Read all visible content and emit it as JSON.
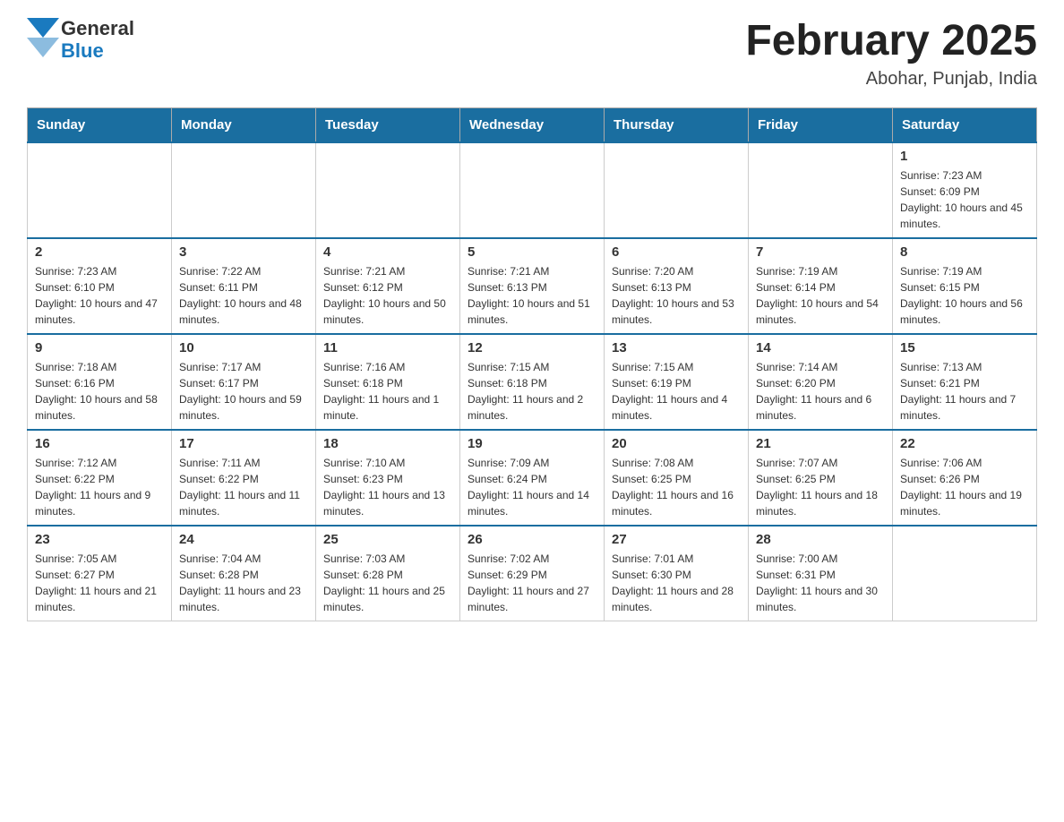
{
  "header": {
    "logo_general": "General",
    "logo_blue": "Blue",
    "month_title": "February 2025",
    "location": "Abohar, Punjab, India"
  },
  "weekdays": [
    "Sunday",
    "Monday",
    "Tuesday",
    "Wednesday",
    "Thursday",
    "Friday",
    "Saturday"
  ],
  "weeks": [
    [
      {
        "day": "",
        "sunrise": "",
        "sunset": "",
        "daylight": ""
      },
      {
        "day": "",
        "sunrise": "",
        "sunset": "",
        "daylight": ""
      },
      {
        "day": "",
        "sunrise": "",
        "sunset": "",
        "daylight": ""
      },
      {
        "day": "",
        "sunrise": "",
        "sunset": "",
        "daylight": ""
      },
      {
        "day": "",
        "sunrise": "",
        "sunset": "",
        "daylight": ""
      },
      {
        "day": "",
        "sunrise": "",
        "sunset": "",
        "daylight": ""
      },
      {
        "day": "1",
        "sunrise": "Sunrise: 7:23 AM",
        "sunset": "Sunset: 6:09 PM",
        "daylight": "Daylight: 10 hours and 45 minutes."
      }
    ],
    [
      {
        "day": "2",
        "sunrise": "Sunrise: 7:23 AM",
        "sunset": "Sunset: 6:10 PM",
        "daylight": "Daylight: 10 hours and 47 minutes."
      },
      {
        "day": "3",
        "sunrise": "Sunrise: 7:22 AM",
        "sunset": "Sunset: 6:11 PM",
        "daylight": "Daylight: 10 hours and 48 minutes."
      },
      {
        "day": "4",
        "sunrise": "Sunrise: 7:21 AM",
        "sunset": "Sunset: 6:12 PM",
        "daylight": "Daylight: 10 hours and 50 minutes."
      },
      {
        "day": "5",
        "sunrise": "Sunrise: 7:21 AM",
        "sunset": "Sunset: 6:13 PM",
        "daylight": "Daylight: 10 hours and 51 minutes."
      },
      {
        "day": "6",
        "sunrise": "Sunrise: 7:20 AM",
        "sunset": "Sunset: 6:13 PM",
        "daylight": "Daylight: 10 hours and 53 minutes."
      },
      {
        "day": "7",
        "sunrise": "Sunrise: 7:19 AM",
        "sunset": "Sunset: 6:14 PM",
        "daylight": "Daylight: 10 hours and 54 minutes."
      },
      {
        "day": "8",
        "sunrise": "Sunrise: 7:19 AM",
        "sunset": "Sunset: 6:15 PM",
        "daylight": "Daylight: 10 hours and 56 minutes."
      }
    ],
    [
      {
        "day": "9",
        "sunrise": "Sunrise: 7:18 AM",
        "sunset": "Sunset: 6:16 PM",
        "daylight": "Daylight: 10 hours and 58 minutes."
      },
      {
        "day": "10",
        "sunrise": "Sunrise: 7:17 AM",
        "sunset": "Sunset: 6:17 PM",
        "daylight": "Daylight: 10 hours and 59 minutes."
      },
      {
        "day": "11",
        "sunrise": "Sunrise: 7:16 AM",
        "sunset": "Sunset: 6:18 PM",
        "daylight": "Daylight: 11 hours and 1 minute."
      },
      {
        "day": "12",
        "sunrise": "Sunrise: 7:15 AM",
        "sunset": "Sunset: 6:18 PM",
        "daylight": "Daylight: 11 hours and 2 minutes."
      },
      {
        "day": "13",
        "sunrise": "Sunrise: 7:15 AM",
        "sunset": "Sunset: 6:19 PM",
        "daylight": "Daylight: 11 hours and 4 minutes."
      },
      {
        "day": "14",
        "sunrise": "Sunrise: 7:14 AM",
        "sunset": "Sunset: 6:20 PM",
        "daylight": "Daylight: 11 hours and 6 minutes."
      },
      {
        "day": "15",
        "sunrise": "Sunrise: 7:13 AM",
        "sunset": "Sunset: 6:21 PM",
        "daylight": "Daylight: 11 hours and 7 minutes."
      }
    ],
    [
      {
        "day": "16",
        "sunrise": "Sunrise: 7:12 AM",
        "sunset": "Sunset: 6:22 PM",
        "daylight": "Daylight: 11 hours and 9 minutes."
      },
      {
        "day": "17",
        "sunrise": "Sunrise: 7:11 AM",
        "sunset": "Sunset: 6:22 PM",
        "daylight": "Daylight: 11 hours and 11 minutes."
      },
      {
        "day": "18",
        "sunrise": "Sunrise: 7:10 AM",
        "sunset": "Sunset: 6:23 PM",
        "daylight": "Daylight: 11 hours and 13 minutes."
      },
      {
        "day": "19",
        "sunrise": "Sunrise: 7:09 AM",
        "sunset": "Sunset: 6:24 PM",
        "daylight": "Daylight: 11 hours and 14 minutes."
      },
      {
        "day": "20",
        "sunrise": "Sunrise: 7:08 AM",
        "sunset": "Sunset: 6:25 PM",
        "daylight": "Daylight: 11 hours and 16 minutes."
      },
      {
        "day": "21",
        "sunrise": "Sunrise: 7:07 AM",
        "sunset": "Sunset: 6:25 PM",
        "daylight": "Daylight: 11 hours and 18 minutes."
      },
      {
        "day": "22",
        "sunrise": "Sunrise: 7:06 AM",
        "sunset": "Sunset: 6:26 PM",
        "daylight": "Daylight: 11 hours and 19 minutes."
      }
    ],
    [
      {
        "day": "23",
        "sunrise": "Sunrise: 7:05 AM",
        "sunset": "Sunset: 6:27 PM",
        "daylight": "Daylight: 11 hours and 21 minutes."
      },
      {
        "day": "24",
        "sunrise": "Sunrise: 7:04 AM",
        "sunset": "Sunset: 6:28 PM",
        "daylight": "Daylight: 11 hours and 23 minutes."
      },
      {
        "day": "25",
        "sunrise": "Sunrise: 7:03 AM",
        "sunset": "Sunset: 6:28 PM",
        "daylight": "Daylight: 11 hours and 25 minutes."
      },
      {
        "day": "26",
        "sunrise": "Sunrise: 7:02 AM",
        "sunset": "Sunset: 6:29 PM",
        "daylight": "Daylight: 11 hours and 27 minutes."
      },
      {
        "day": "27",
        "sunrise": "Sunrise: 7:01 AM",
        "sunset": "Sunset: 6:30 PM",
        "daylight": "Daylight: 11 hours and 28 minutes."
      },
      {
        "day": "28",
        "sunrise": "Sunrise: 7:00 AM",
        "sunset": "Sunset: 6:31 PM",
        "daylight": "Daylight: 11 hours and 30 minutes."
      },
      {
        "day": "",
        "sunrise": "",
        "sunset": "",
        "daylight": ""
      }
    ]
  ]
}
